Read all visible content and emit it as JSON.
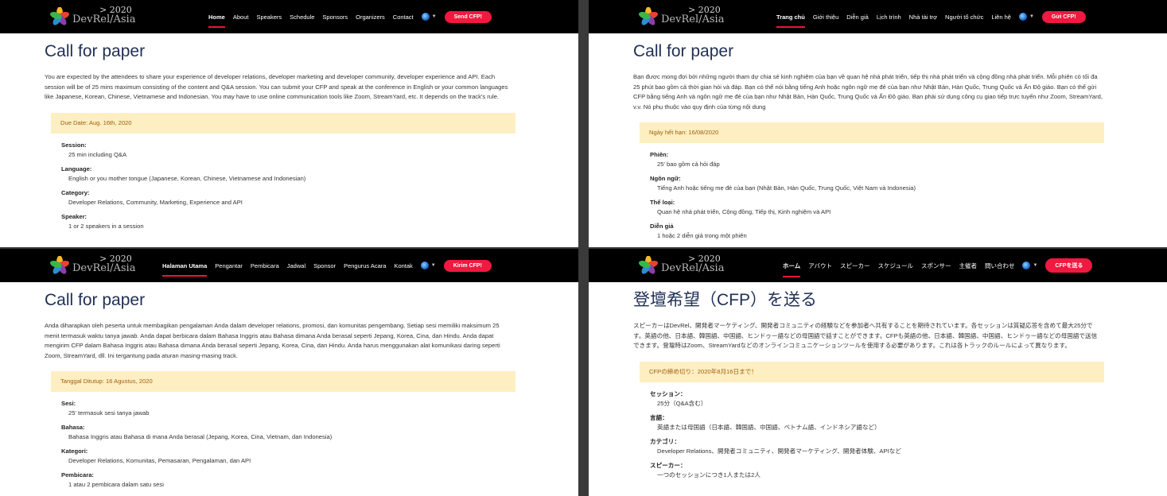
{
  "brand": {
    "year": "> 2020",
    "name": "DevRel/Asia"
  },
  "panels": [
    {
      "lang": "en",
      "nav": [
        {
          "label": "Home",
          "active": true
        },
        {
          "label": "About"
        },
        {
          "label": "Speakers"
        },
        {
          "label": "Schedule"
        },
        {
          "label": "Sponsors"
        },
        {
          "label": "Organizers"
        },
        {
          "label": "Contact"
        }
      ],
      "cfp_button": "Send CFP!",
      "title": "Call for paper",
      "intro": "You are expected by the attendees to share your experience of developer relations, developer marketing and developer community, developer experience and API. Each session will be of 25 mins maximum consisting of the content and Q&A session. You can submit your CFP and speak at the conference in English or your common languages like Japanese, Korean, Chinese, Vietnamese and Indonesian. You may have to use online communication tools like Zoom, StreamYard, etc. It depends on the track's rule.",
      "due_date": "Due Date: Aug. 16th, 2020",
      "details": [
        {
          "term": "Session:",
          "desc": "25 min including Q&A"
        },
        {
          "term": "Language:",
          "desc": "English or you mother tongue (Japanese, Korean, Chinese, Vietnamese and Indonesian)"
        },
        {
          "term": "Category:",
          "desc": "Developer Relations, Community, Marketing, Experience and API"
        },
        {
          "term": "Speaker:",
          "desc": "1 or 2 speakers in a session"
        }
      ]
    },
    {
      "lang": "vi",
      "nav": [
        {
          "label": "Trang chủ",
          "active": true
        },
        {
          "label": "Giới thiệu"
        },
        {
          "label": "Diễn giả"
        },
        {
          "label": "Lịch trình"
        },
        {
          "label": "Nhà tài trợ"
        },
        {
          "label": "Người tổ chức"
        },
        {
          "label": "Liên hệ"
        }
      ],
      "cfp_button": "Gửi CFP!",
      "title": "Call for paper",
      "intro": "Bạn được mong đợi bởi những người tham dự chia sẻ kinh nghiệm của bạn về quan hệ nhà phát triển, tiếp thị nhà phát triển và cộng đồng nhà phát triển. Mỗi phiên có tối đa 25 phút bao gồm cả thời gian hỏi và đáp. Bạn có thể nói bằng tiếng Anh hoặc ngôn ngữ mẹ đẻ của bạn như Nhật Bản, Hàn Quốc, Trung Quốc và Ấn Độ giáo. Bạn có thể gửi CFP bằng tiếng Anh và ngôn ngữ mẹ đẻ của bạn như Nhật Bản, Hàn Quốc, Trung Quốc và Ấn Độ giáo. Bạn phải sử dụng công cụ giao tiếp trực tuyến như Zoom, StreamYard, v.v. Nó phụ thuộc vào quy định của từng nội dung",
      "due_date": "Ngày hết hạn: 16/08/2020",
      "details": [
        {
          "term": "Phiên:",
          "desc": "25' bao gồm cả hỏi đáp"
        },
        {
          "term": "Ngôn ngữ:",
          "desc": "Tiếng Anh hoặc tiếng mẹ đẻ của bạn (Nhật Bản, Hàn Quốc, Trung Quốc, Việt Nam và Indonesia)"
        },
        {
          "term": "Thể loại:",
          "desc": "Quan hệ nhà phát triển, Cộng đồng, Tiếp thị, Kinh nghiệm và API"
        },
        {
          "term": "Diễn giả",
          "desc": "1 hoặc 2 diễn giả trong một phiên"
        }
      ]
    },
    {
      "lang": "id",
      "nav": [
        {
          "label": "Halaman Utama",
          "active": true
        },
        {
          "label": "Pengantar"
        },
        {
          "label": "Pembicara"
        },
        {
          "label": "Jadwal"
        },
        {
          "label": "Sponsor"
        },
        {
          "label": "Pengurus Acara"
        },
        {
          "label": "Kontak"
        }
      ],
      "cfp_button": "Kirim CFP!",
      "title": "Call for paper",
      "intro": "Anda diharapkan oleh peserta untuk membagikan pengalaman Anda dalam developer relations, promosi, dan komunitas pengembang. Setiap sesi memiliki maksimum 25 menit termasuk waktu tanya jawab. Anda dapat berbicara dalam Bahasa Inggris atau Bahasa dimana Anda berasal seperti Jepang, Korea, Cina, dan Hindu. Anda dapat mengirim CFP dalam Bahasa Inggris atau Bahasa dimana Anda berasal seperti Jepang, Korea, Cina, dan Hindu. Anda harus menggunakan alat komunikasi daring seperti Zoom, StreamYard, dll. Ini tergantung pada aturan masing-masing track.",
      "due_date": "Tanggal Ditutup: 16 Agustus, 2020",
      "details": [
        {
          "term": "Sesi:",
          "desc": "25' termasuk sesi tanya jawab"
        },
        {
          "term": "Bahasa:",
          "desc": "Bahasa Inggris atau Bahasa di mana Anda berasal (Jepang, Korea, Cina, Vietnam, dan Indonesia)"
        },
        {
          "term": "Kategori:",
          "desc": "Developer Relations, Komunitas, Pemasaran, Pengalaman, dan API"
        },
        {
          "term": "Pembicara:",
          "desc": "1 atau 2 pembicara dalam satu sesi"
        }
      ]
    },
    {
      "lang": "ja",
      "nav": [
        {
          "label": "ホーム",
          "active": true
        },
        {
          "label": "アバウト"
        },
        {
          "label": "スピーカー"
        },
        {
          "label": "スケジュール"
        },
        {
          "label": "スポンサー"
        },
        {
          "label": "主催者"
        },
        {
          "label": "問い合わせ"
        }
      ],
      "cfp_button": "CFPを送る",
      "title": "登壇希望（CFP）を送る",
      "intro": "スピーカーはDevRel、開発者マーケティング、開発者コミュニティの経験などを参加者へ共有することを期待されています。各セッションは質疑応答を含めて最大25分です。英語の他、日本語、韓国語、中国語、ヒンドゥー語などの母国語で話すことができます。CFPも英語の他、日本語、韓国語、中国語、ヒンドゥー語などの母国語で送信できます。登壇時はZoom、StreamYardなどのオンラインコミュニケーションツールを使用する必要があります。これは各トラックのルールによって異なります。",
      "due_date": "CFPの締め切り：2020年8月16日まで！",
      "details": [
        {
          "term": "セッション：",
          "desc": "25分（Q&A含む）"
        },
        {
          "term": "言語：",
          "desc": "英語または母国語（日本語、韓国語、中国語、ベトナム語、インドネシア語など）"
        },
        {
          "term": "カテゴリ：",
          "desc": "Developer Relations、開発者コミュニティ、開発者マーケティング、開発者体験、APIなど"
        },
        {
          "term": "スピーカー：",
          "desc": "一つのセッションにつき1人または2人"
        }
      ]
    }
  ]
}
